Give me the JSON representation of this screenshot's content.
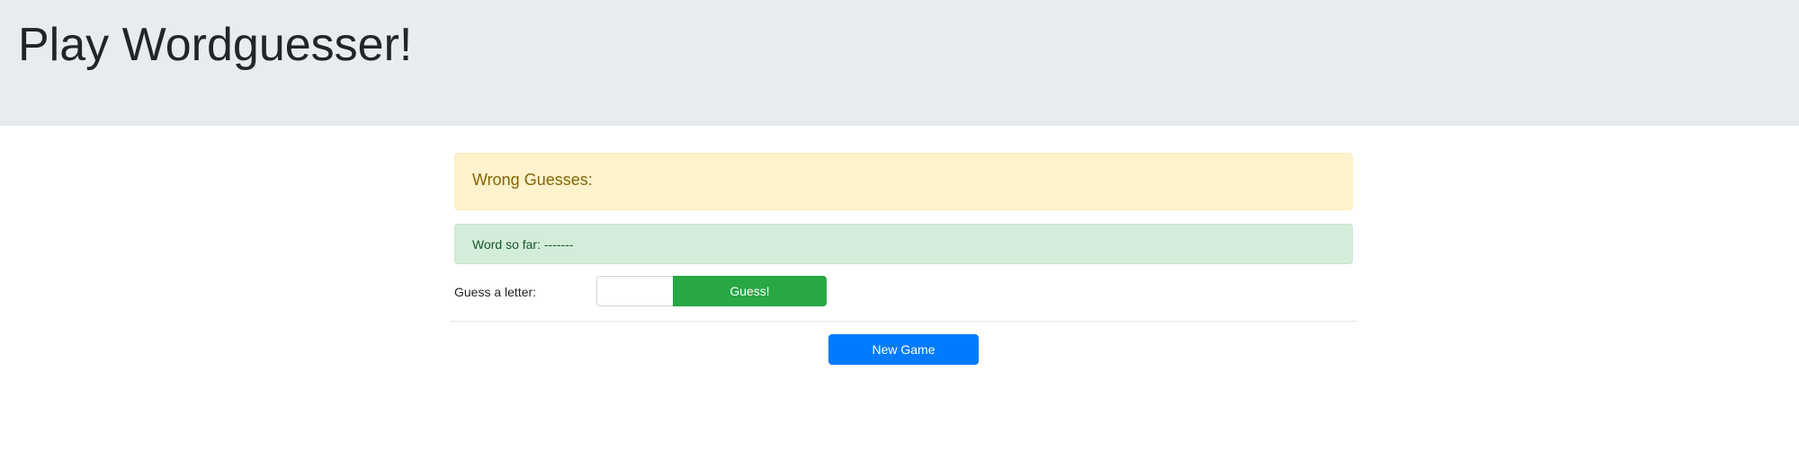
{
  "header": {
    "title": "Play Wordguesser!"
  },
  "wrong_guesses": {
    "label": "Wrong Guesses:"
  },
  "word_progress": {
    "label": "Word so far: -------"
  },
  "guess_form": {
    "label": "Guess a letter:",
    "input_value": "",
    "button_label": "Guess!"
  },
  "new_game": {
    "button_label": "New Game"
  },
  "colors": {
    "header_bg": "#e9ecef",
    "warning_bg": "#fff3cd",
    "success_bg": "#d4edda",
    "guess_button": "#28a745",
    "new_game_button": "#007bff"
  }
}
